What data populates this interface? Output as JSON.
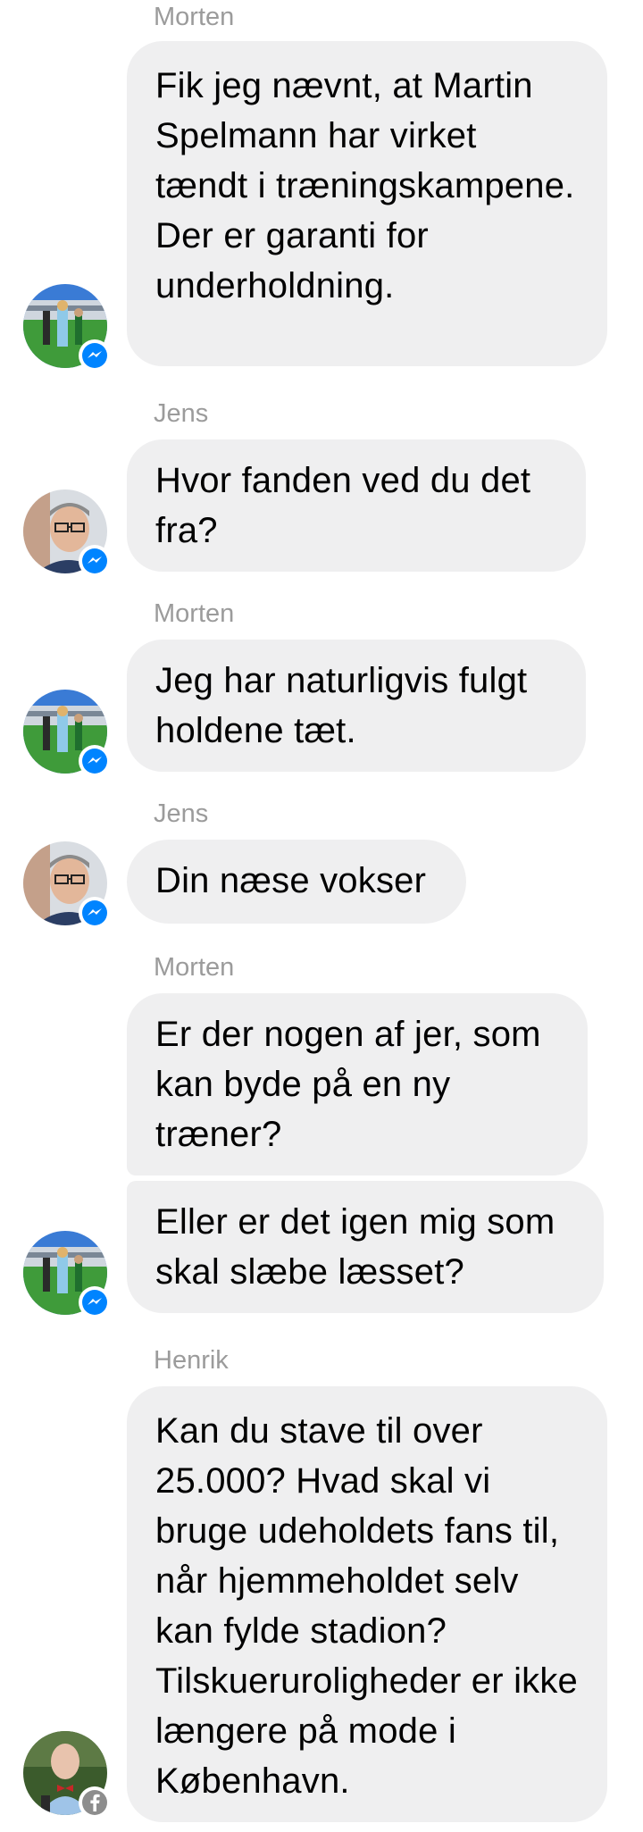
{
  "conversation": {
    "groups": [
      {
        "sender": "Morten",
        "avatar": "stadium-avatar",
        "badge": "messenger-badge-icon",
        "messages": [
          "Fik jeg nævnt, at Martin Spelmann har virket tændt i træningskampene. Der er garanti for underholdning."
        ]
      },
      {
        "sender": "Jens",
        "avatar": "man-glasses-avatar",
        "badge": "messenger-badge-icon",
        "messages": [
          "Hvor fanden ved du det fra?"
        ]
      },
      {
        "sender": "Morten",
        "avatar": "stadium-avatar",
        "badge": "messenger-badge-icon",
        "messages": [
          "Jeg har naturligvis fulgt holdene tæt."
        ]
      },
      {
        "sender": "Jens",
        "avatar": "man-glasses-avatar",
        "badge": "messenger-badge-icon",
        "messages": [
          "Din næse vokser"
        ]
      },
      {
        "sender": "Morten",
        "avatar": "stadium-avatar",
        "badge": "messenger-badge-icon",
        "messages": [
          "Er der nogen af jer, som kan byde på en ny træner?",
          "Eller er det igen mig som skal slæbe læsset?"
        ]
      },
      {
        "sender": "Henrik",
        "avatar": "man-bowtie-avatar",
        "badge": "facebook-badge-icon",
        "messages": [
          "Kan du stave til over 25.000? Hvad skal vi bruge udeholdets fans til, når hjemmeholdet selv kan fylde stadion? Tilskueruroligheder er ikke længere på mode i København."
        ]
      }
    ]
  },
  "colors": {
    "bubble": "#efeff0",
    "sender_name": "#9b9b9b",
    "messenger_blue": "#0084ff",
    "facebook_grey": "#8d8d8d"
  }
}
